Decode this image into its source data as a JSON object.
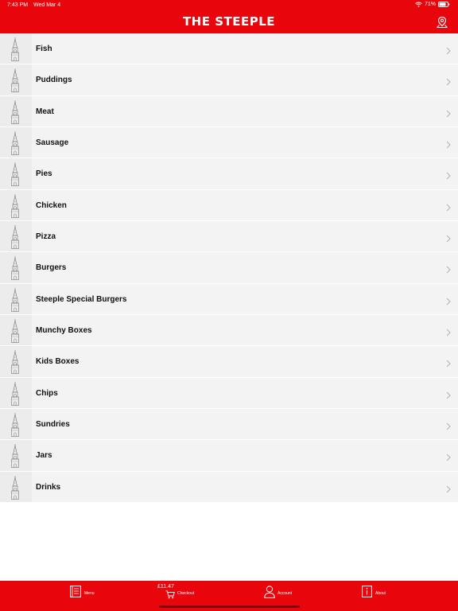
{
  "status_bar": {
    "time": "7:43 PM",
    "date": "Wed Mar 4",
    "battery": "71%"
  },
  "header": {
    "title": "THE STEEPLE",
    "location_icon": "location-pin-icon"
  },
  "categories": [
    "Fish",
    "Puddings",
    "Meat",
    "Sausage",
    "Pies",
    "Chicken",
    "Pizza",
    "Burgers",
    "Steeple Special Burgers",
    "Munchy Boxes",
    "Kids Boxes",
    "Chips",
    "Sundries",
    "Jars",
    "Drinks"
  ],
  "tabbar": {
    "menu_label": "Menu",
    "checkout_label": "Checkout",
    "cart_total": "£11.47",
    "account_label": "Account",
    "about_label": "About"
  },
  "colors": {
    "brand": "#e8060c",
    "row_bg": "#f3f3f3"
  }
}
